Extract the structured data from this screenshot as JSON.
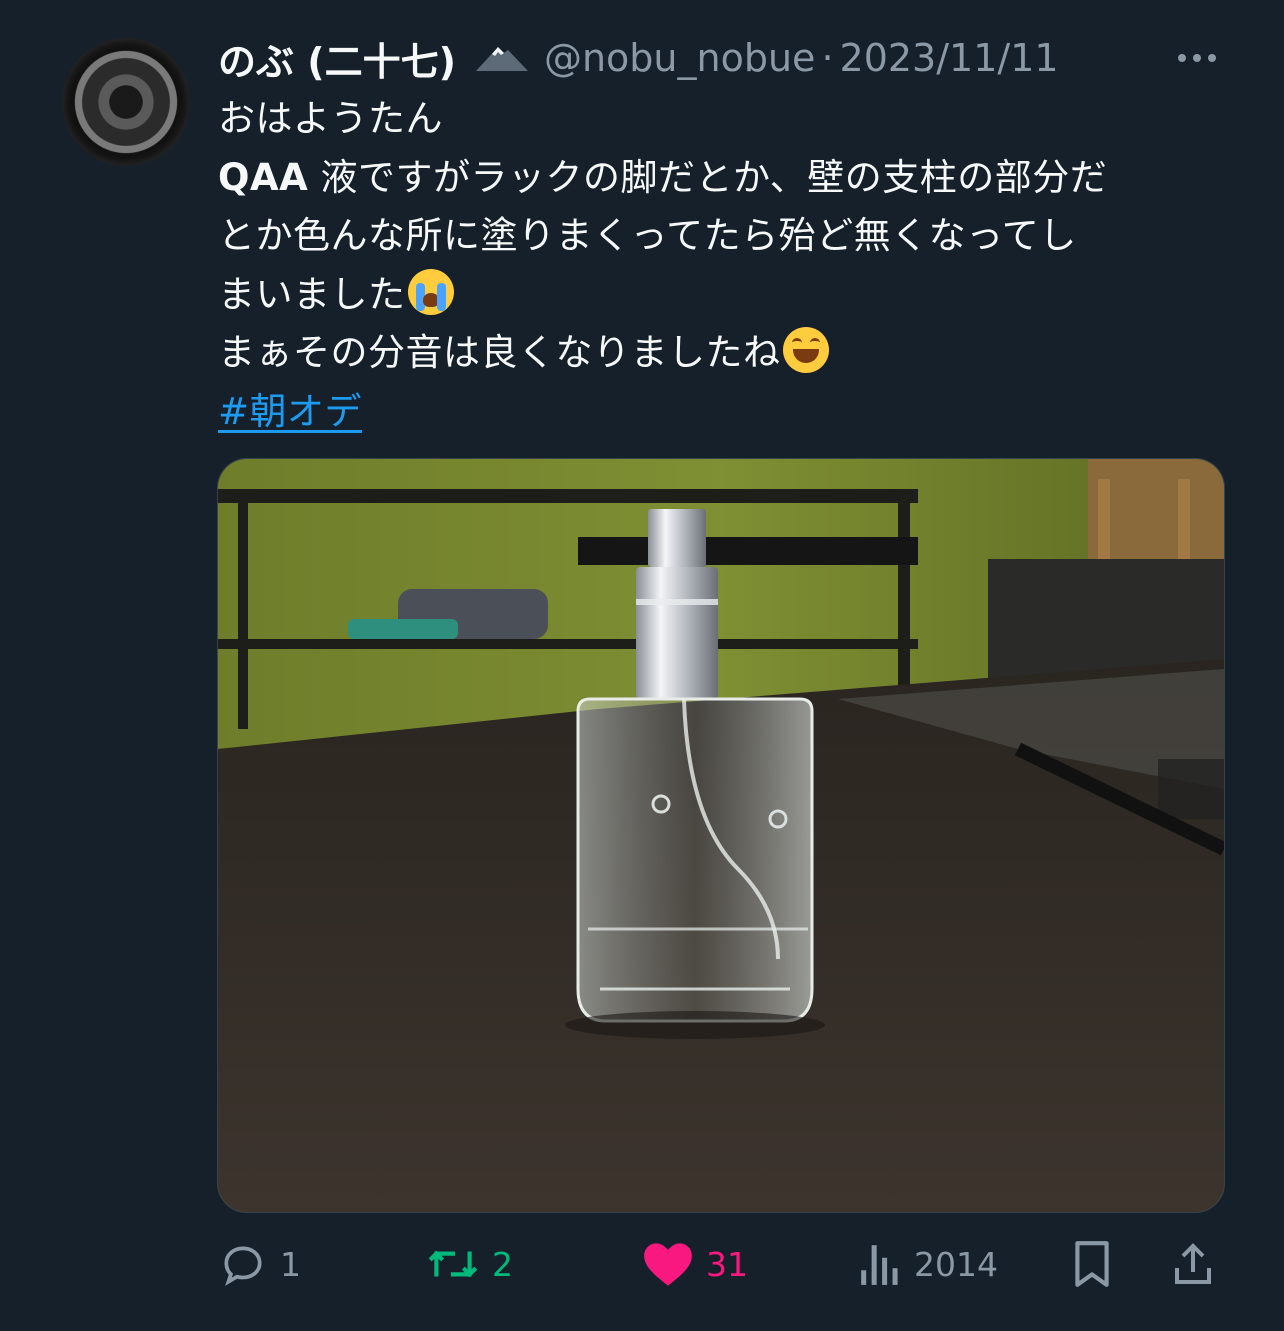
{
  "tweet": {
    "author_name": "のぶ (二十七)",
    "handle": "@nobu_nobue",
    "separator": "·",
    "date": "2023/11/11",
    "lines": {
      "l1": "おはようたん",
      "l2_strong": "QAA",
      "l2_rest": " 液ですがラックの脚だとか、壁の支柱の部分だ",
      "l3": "とか色んな所に塗りまくってたら殆ど無くなってし",
      "l4": "まいました",
      "l5": "まぁその分音は良くなりましたね"
    },
    "hashtag": "#朝オデ"
  },
  "icons": {
    "more": "more-horizontal-icon",
    "reply": "reply-icon",
    "retweet": "retweet-icon",
    "like": "heart-icon",
    "views": "analytics-icon",
    "bookmark": "bookmark-icon",
    "share": "share-icon",
    "emoji1": "loudly-crying-face",
    "emoji2": "grinning-squinting-face"
  },
  "stats": {
    "replies": "1",
    "retweets": "2",
    "likes": "31",
    "views": "2014"
  },
  "colors": {
    "background": "#15202b",
    "accent": "#1d9bf0",
    "retweet": "#00ba7c",
    "like": "#f91880",
    "muted": "#8b98a5"
  }
}
